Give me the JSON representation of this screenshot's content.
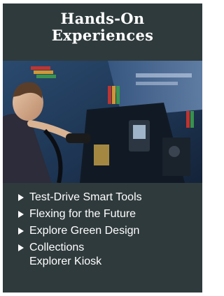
{
  "card": {
    "title_line1": "Hands-On",
    "title_line2": "Experiences",
    "background": "#2f3a3c",
    "image": {
      "icon": "kiosk-photo-icon",
      "description_role": "photo"
    },
    "links": [
      {
        "label": "Test-Drive Smart Tools",
        "icon": "triangle-right-icon"
      },
      {
        "label": "Flexing for the Future",
        "icon": "triangle-right-icon"
      },
      {
        "label": "Explore Green Design",
        "icon": "triangle-right-icon"
      },
      {
        "label": "Collections Explorer Kiosk",
        "icon": "triangle-right-icon"
      }
    ]
  }
}
